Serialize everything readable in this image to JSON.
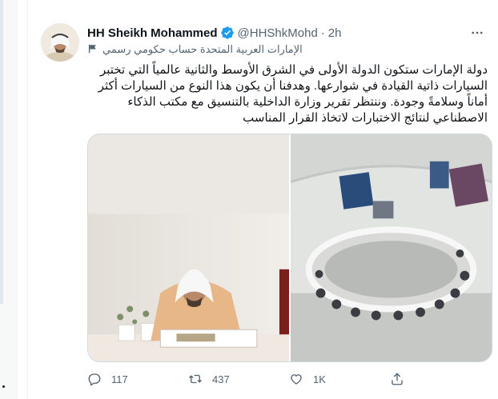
{
  "tweet": {
    "author": {
      "display_name": "HH Sheikh Mohammed",
      "handle": "@HHShkMohd",
      "verified": true
    },
    "separator": "·",
    "time": "2h",
    "gov_label": "الإمارات العربية المتحدة حساب حكومي رسمي",
    "text": "دولة الإمارات ستكون الدولة الأولى في الشرق الأوسط والثانية عالمياً التي تختبر السيارات ذاتية القيادة في شوارعها. وهدفنا أن يكون هذا النوع من السيارات أكثر أماناً وسلامةً وجودة. وننتظر تقرير وزارة الداخلية بالتنسيق مع مكتب الذكاء الاصطناعي لنتائج الاختبارات لاتخاذ القرار المناسب",
    "media": [
      {
        "name": "photo-sheikh-meeting"
      },
      {
        "name": "photo-cabinet-room"
      }
    ],
    "actions": {
      "reply_count": "117",
      "retweet_count": "437",
      "like_count": "1K"
    }
  },
  "colors": {
    "text_primary": "#0f1419",
    "text_secondary": "#536471",
    "verified_blue": "#1d9bf0",
    "border": "#cfd9de"
  },
  "icons": [
    "verified-badge-icon",
    "more-icon",
    "flag-icon",
    "reply-icon",
    "retweet-icon",
    "like-icon",
    "share-icon"
  ]
}
